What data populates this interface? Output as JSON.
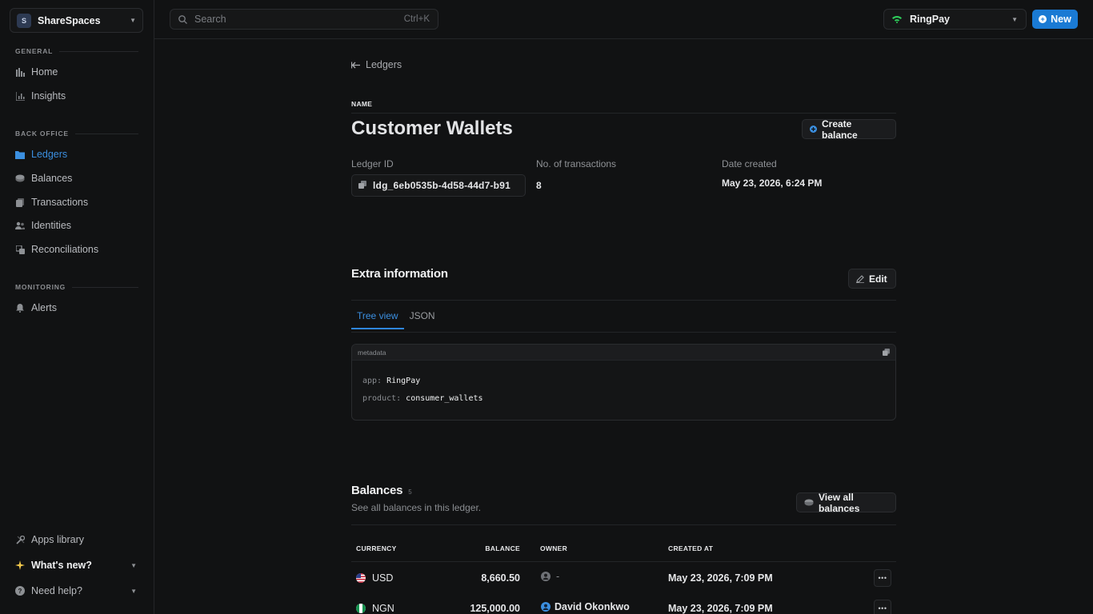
{
  "workspace": {
    "initial": "S",
    "name": "ShareSpaces"
  },
  "sidebar": {
    "sections": [
      {
        "label": "GENERAL"
      },
      {
        "label": "BACK OFFICE"
      },
      {
        "label": "MONITORING"
      }
    ],
    "items": [
      {
        "label": "Home",
        "icon": "home-icon"
      },
      {
        "label": "Insights",
        "icon": "chart-icon"
      },
      {
        "label": "Ledgers",
        "icon": "folder-icon"
      },
      {
        "label": "Balances",
        "icon": "coins-icon"
      },
      {
        "label": "Transactions",
        "icon": "document-icon"
      },
      {
        "label": "Identities",
        "icon": "users-icon"
      },
      {
        "label": "Reconciliations",
        "icon": "reconcile-icon"
      },
      {
        "label": "Alerts",
        "icon": "bell-icon"
      }
    ],
    "footer": [
      {
        "label": "Apps library",
        "icon": "tools-icon"
      },
      {
        "label": "What's new?",
        "icon": "sparkle-icon"
      },
      {
        "label": "Need help?",
        "icon": "help-icon"
      }
    ]
  },
  "header": {
    "search_placeholder": "Search",
    "search_shortcut": "Ctrl+K",
    "org_name": "RingPay",
    "new_label": "New"
  },
  "ledger": {
    "back_label": "Ledgers",
    "name_label": "NAME",
    "title": "Customer Wallets",
    "create_balance_label": "Create balance",
    "fields": {
      "id_label": "Ledger ID",
      "id_value": "ldg_6eb0535b-4d58-44d7-b91",
      "tx_label": "No. of transactions",
      "tx_value": "8",
      "date_label": "Date created",
      "date_value": "May 23, 2026, 6:24 PM"
    }
  },
  "extra": {
    "title": "Extra information",
    "edit_label": "Edit",
    "tabs": [
      "Tree view",
      "JSON"
    ],
    "meta_header": "metadata",
    "entries": [
      {
        "key": "app:",
        "value": "RingPay"
      },
      {
        "key": "product:",
        "value": "consumer_wallets"
      }
    ]
  },
  "balances": {
    "title": "Balances",
    "count": "5",
    "subtitle": "See all balances in this ledger.",
    "view_all_label": "View all balances",
    "columns": [
      "CURRENCY",
      "BALANCE",
      "OWNER",
      "CREATED AT"
    ],
    "rows": [
      {
        "currency": "USD",
        "balance": "8,660.50",
        "owner": "-",
        "created_at": "May 23, 2026, 7:09 PM"
      },
      {
        "currency": "NGN",
        "balance": "125,000.00",
        "owner": "David Okonkwo",
        "created_at": "May 23, 2026, 7:09 PM"
      }
    ]
  },
  "colors": {
    "accent": "#1a7ad4",
    "active_link": "#3b8fe0",
    "background": "#111213"
  }
}
